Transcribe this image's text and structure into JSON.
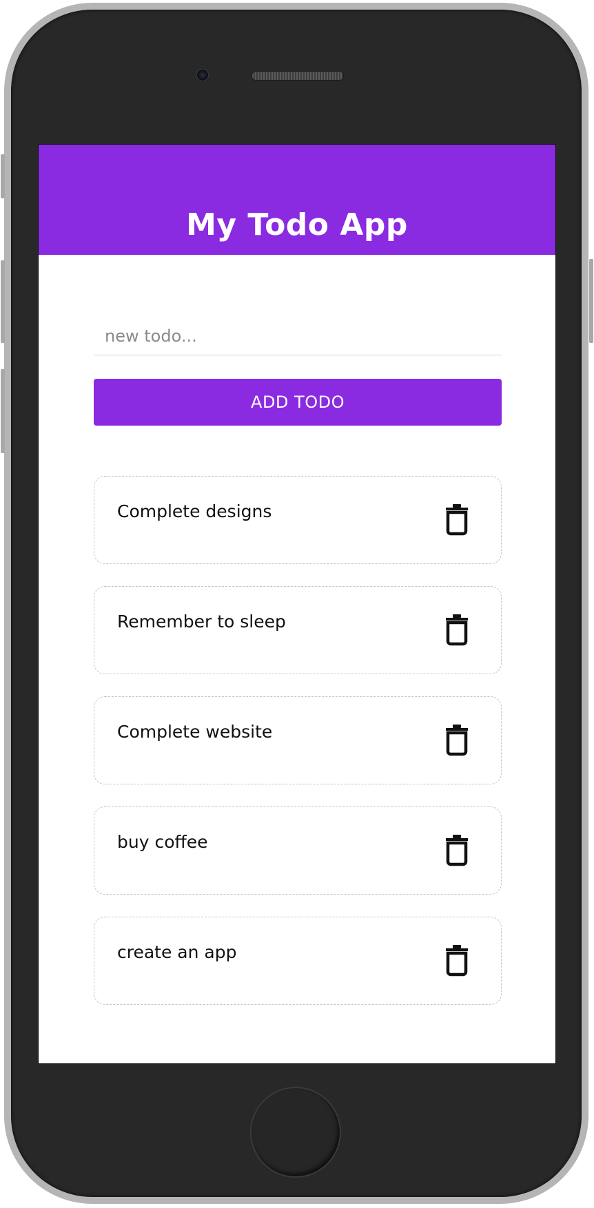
{
  "app": {
    "title": "My Todo App",
    "accent_color": "#8a2be2"
  },
  "form": {
    "input_value": "",
    "input_placeholder": "new todo...",
    "add_button_label": "ADD TODO"
  },
  "todos": [
    {
      "text": "Complete designs",
      "delete_icon": "trash-icon"
    },
    {
      "text": "Remember to sleep",
      "delete_icon": "trash-icon"
    },
    {
      "text": "Complete website",
      "delete_icon": "trash-icon"
    },
    {
      "text": "buy coffee",
      "delete_icon": "trash-icon"
    },
    {
      "text": "create an app",
      "delete_icon": "trash-icon"
    }
  ]
}
